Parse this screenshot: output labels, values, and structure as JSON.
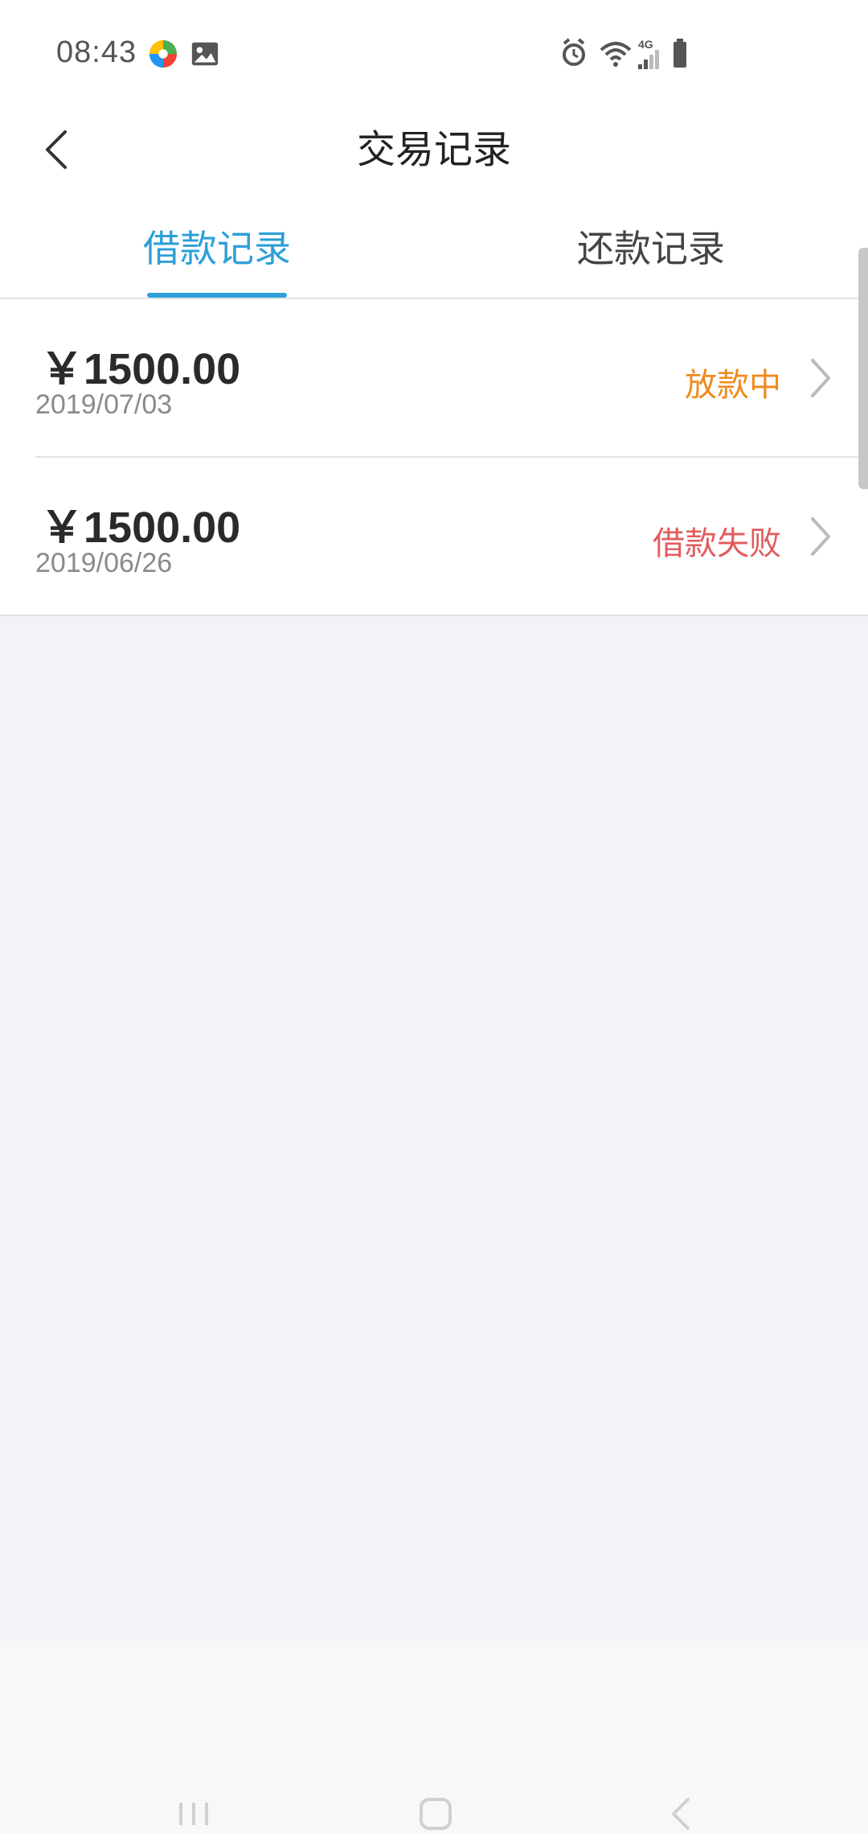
{
  "status_bar": {
    "time": "08:43",
    "network": "4G",
    "icons": [
      "app-notification-icon",
      "gallery-icon",
      "alarm-icon",
      "wifi-icon",
      "signal-icon",
      "battery-icon"
    ]
  },
  "header": {
    "title": "交易记录",
    "back_icon": "back-arrow-icon"
  },
  "tabs": [
    {
      "label": "借款记录",
      "active": true
    },
    {
      "label": "还款记录",
      "active": false
    }
  ],
  "records": [
    {
      "amount": "￥1500.00",
      "date": "2019/07/03",
      "status": "放款中",
      "status_color": "#f08a1c"
    },
    {
      "amount": "￥1500.00",
      "date": "2019/06/26",
      "status": "借款失败",
      "status_color": "#e25c5c"
    }
  ],
  "colors": {
    "accent": "#2e9fd8",
    "background": "#f2f2f7"
  },
  "nav_bar": {
    "icons": [
      "recent-apps-icon",
      "home-icon",
      "back-icon"
    ]
  }
}
